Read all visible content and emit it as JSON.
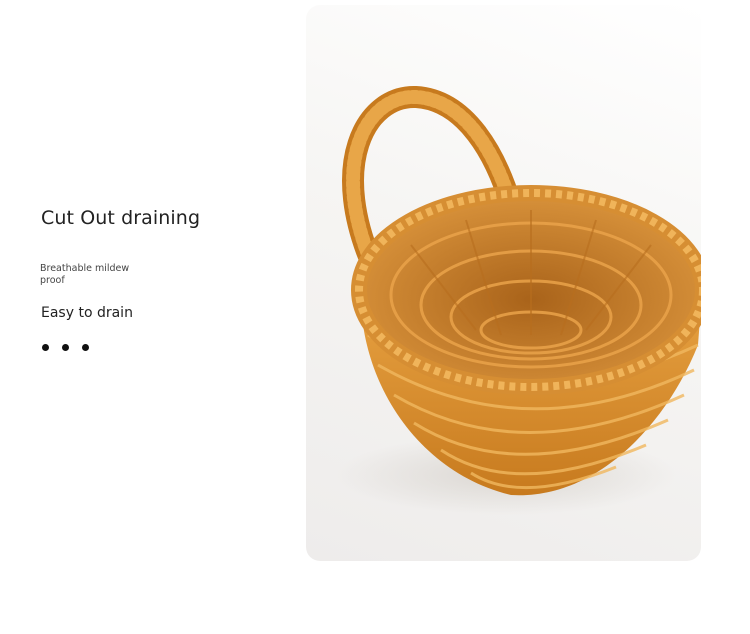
{
  "heading": {
    "title": "Cut Out draining",
    "subtitle": "Breathable mildew proof",
    "feature": "Easy to drain"
  },
  "pagination": {
    "dot_count": 3
  },
  "photo": {
    "subject": "woven-basket-with-handle",
    "basket_color": "#d48a2a",
    "background_color": "#f4f3f1"
  }
}
